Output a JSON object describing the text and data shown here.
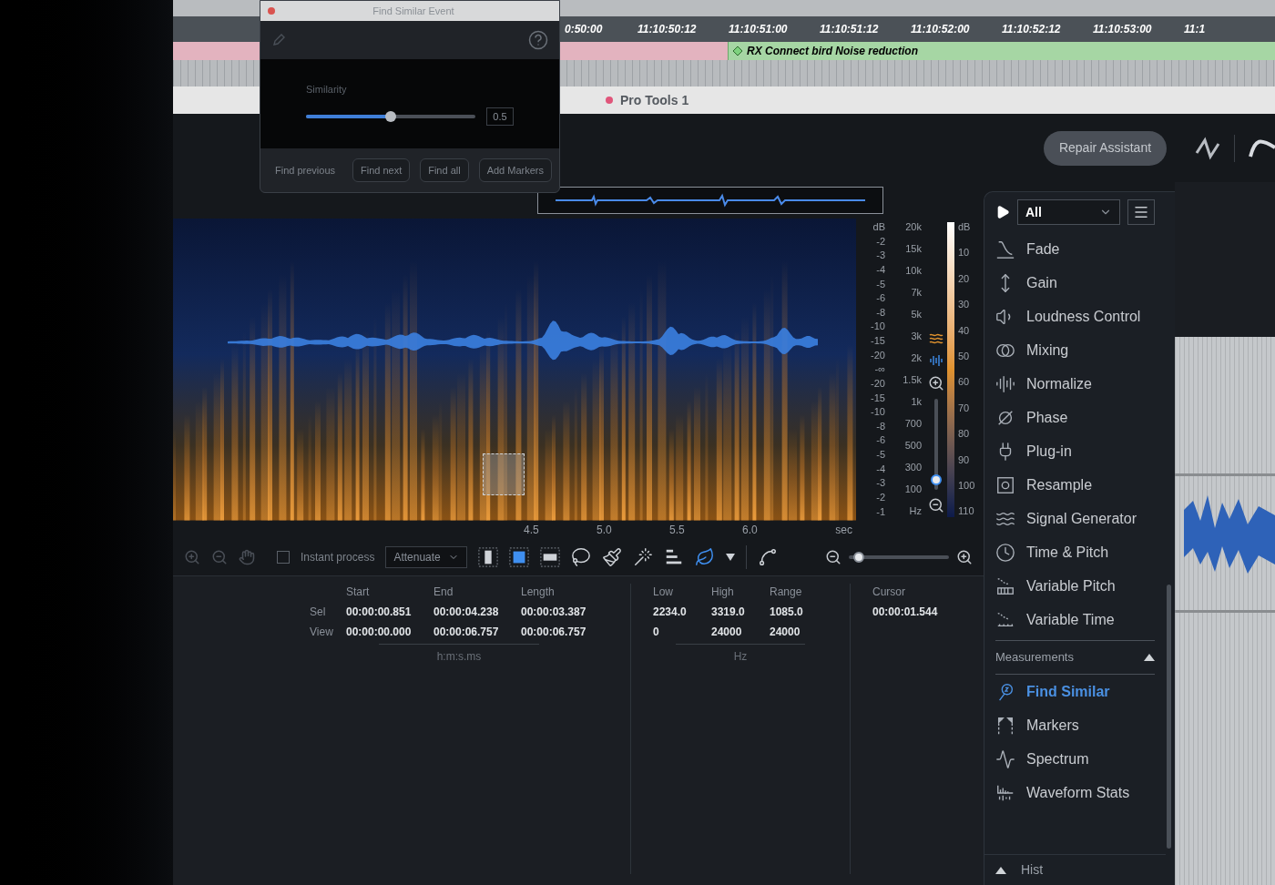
{
  "pro_tools": {
    "timecodes": [
      "0:50:00",
      "11:10:50:12",
      "11:10:51:00",
      "11:10:51:12",
      "11:10:52:00",
      "11:10:52:12",
      "11:10:53:00",
      "11:1"
    ],
    "clip": {
      "name": "RX Connect bird Noise reduction"
    }
  },
  "dialog": {
    "title": "Find Similar Event",
    "similarity": {
      "label": "Similarity",
      "level": 0.5,
      "value": "0.5"
    },
    "buttons": [
      {
        "label": "Find previous",
        "kind": "text"
      },
      {
        "label": "Find next",
        "kind": "outlined"
      },
      {
        "label": "Find all",
        "kind": "outlined"
      },
      {
        "label": "Add Markers",
        "kind": "outlined"
      }
    ]
  },
  "window": {
    "title": "Pro Tools 1"
  },
  "toolbar": {
    "repair_assistant": "Repair Assistant"
  },
  "editor": {
    "db_scale": [
      "dB",
      "-2",
      "-3",
      "-4",
      "-5",
      "-6",
      "-8",
      "-10",
      "-15",
      "-20",
      "-∞",
      "-20",
      "-15",
      "-10",
      "-8",
      "-6",
      "-5",
      "-4",
      "-3",
      "-2",
      "-1"
    ],
    "hz_scale": [
      "20k",
      "15k",
      "10k",
      "7k",
      "5k",
      "3k",
      "2k",
      "1.5k",
      "1k",
      "700",
      "500",
      "300",
      "100",
      "Hz"
    ],
    "meter_scale": [
      "dB",
      "10",
      "20",
      "30",
      "40",
      "50",
      "60",
      "70",
      "80",
      "90",
      "100",
      "110"
    ],
    "time_axis": {
      "ticks": [
        "4.5",
        "5.0",
        "5.5",
        "6.0"
      ],
      "unit": "sec"
    },
    "vertical_zoom": {
      "level": 0.05
    },
    "instant_process": {
      "label": "Instant process",
      "checked": false
    },
    "mode": {
      "value": "Attenuate"
    },
    "tools": [
      {
        "kind": "time",
        "selected": false
      },
      {
        "kind": "time_frequency",
        "selected": true
      },
      {
        "kind": "frequency",
        "selected": false
      },
      {
        "kind": "lasso",
        "selected": false
      },
      {
        "kind": "brush",
        "selected": false
      },
      {
        "kind": "wand",
        "selected": false
      },
      {
        "kind": "harmonic",
        "selected": false
      },
      {
        "kind": "find_similar",
        "selected": true
      }
    ],
    "horizontal_zoom": {
      "level": 0.05
    }
  },
  "info": {
    "time": {
      "columns": [
        "Start",
        "End",
        "Length"
      ],
      "rows": [
        {
          "label": "Sel",
          "values": [
            "00:00:00.851",
            "00:00:04.238",
            "00:00:03.387"
          ]
        },
        {
          "label": "View",
          "values": [
            "00:00:00.000",
            "00:00:06.757",
            "00:00:06.757"
          ]
        }
      ],
      "unit": "h:m:s.ms"
    },
    "frequency": {
      "columns": [
        "Low",
        "High",
        "Range"
      ],
      "rows": [
        [
          "2234.0",
          "3319.0",
          "1085.0"
        ],
        [
          "0",
          "24000",
          "24000"
        ]
      ],
      "unit": "Hz"
    },
    "cursor": {
      "label": "Cursor",
      "value": "00:00:01.544"
    }
  },
  "modules": {
    "filter": "All",
    "groups": [
      {
        "items": [
          {
            "label": "Fade",
            "kind": "fade",
            "selected": false
          },
          {
            "label": "Gain",
            "kind": "gain",
            "selected": false
          },
          {
            "label": "Loudness Control",
            "kind": "loudness",
            "selected": false
          },
          {
            "label": "Mixing",
            "kind": "mixing",
            "selected": false
          },
          {
            "label": "Normalize",
            "kind": "normalize",
            "selected": false
          },
          {
            "label": "Phase",
            "kind": "phase",
            "selected": false
          },
          {
            "label": "Plug-in",
            "kind": "plugin",
            "selected": false
          },
          {
            "label": "Resample",
            "kind": "resample",
            "selected": false
          },
          {
            "label": "Signal Generator",
            "kind": "signal",
            "selected": false
          },
          {
            "label": "Time & Pitch",
            "kind": "time_pitch",
            "selected": false
          },
          {
            "label": "Variable Pitch",
            "kind": "variable_pitch",
            "selected": false
          },
          {
            "label": "Variable Time",
            "kind": "variable_time",
            "selected": false
          }
        ]
      },
      {
        "title": "Measurements",
        "expanded": true,
        "items": [
          {
            "label": "Find Similar",
            "kind": "find_similar",
            "selected": true
          },
          {
            "label": "Markers",
            "kind": "markers",
            "selected": false
          },
          {
            "label": "Spectrum",
            "kind": "spectrum",
            "selected": false
          },
          {
            "label": "Waveform Stats",
            "kind": "waveform_stats",
            "selected": false
          }
        ]
      }
    ],
    "footer": "Hist"
  }
}
